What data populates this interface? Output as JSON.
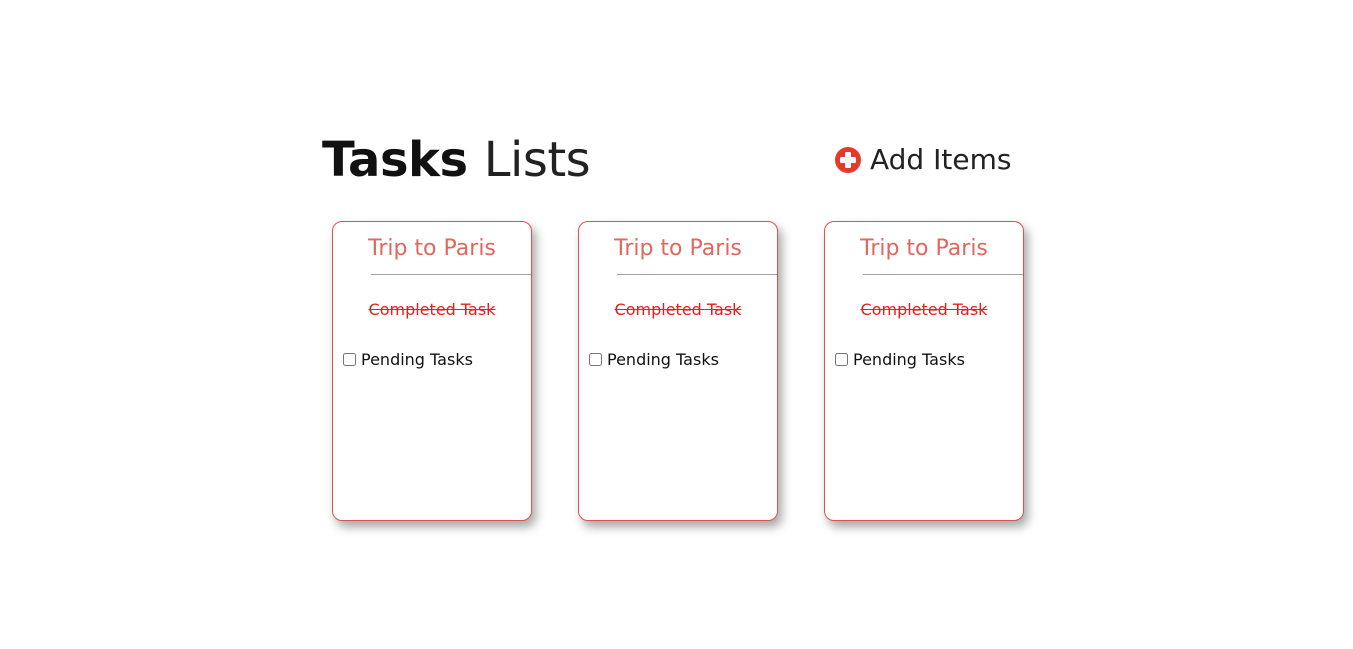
{
  "header": {
    "title_bold": "Tasks",
    "title_light": "Lists",
    "add_label": "Add Items",
    "add_icon": "plus-circle-icon",
    "accent_color": "#e53a2b"
  },
  "cards": [
    {
      "title": "Trip to Paris",
      "completed_label": "Completed Task",
      "pending_label": "Pending Tasks",
      "pending_checked": false
    },
    {
      "title": "Trip to Paris",
      "completed_label": "Completed Task",
      "pending_label": "Pending Tasks",
      "pending_checked": false
    },
    {
      "title": "Trip to Paris",
      "completed_label": "Completed Task",
      "pending_label": "Pending Tasks",
      "pending_checked": false
    }
  ]
}
